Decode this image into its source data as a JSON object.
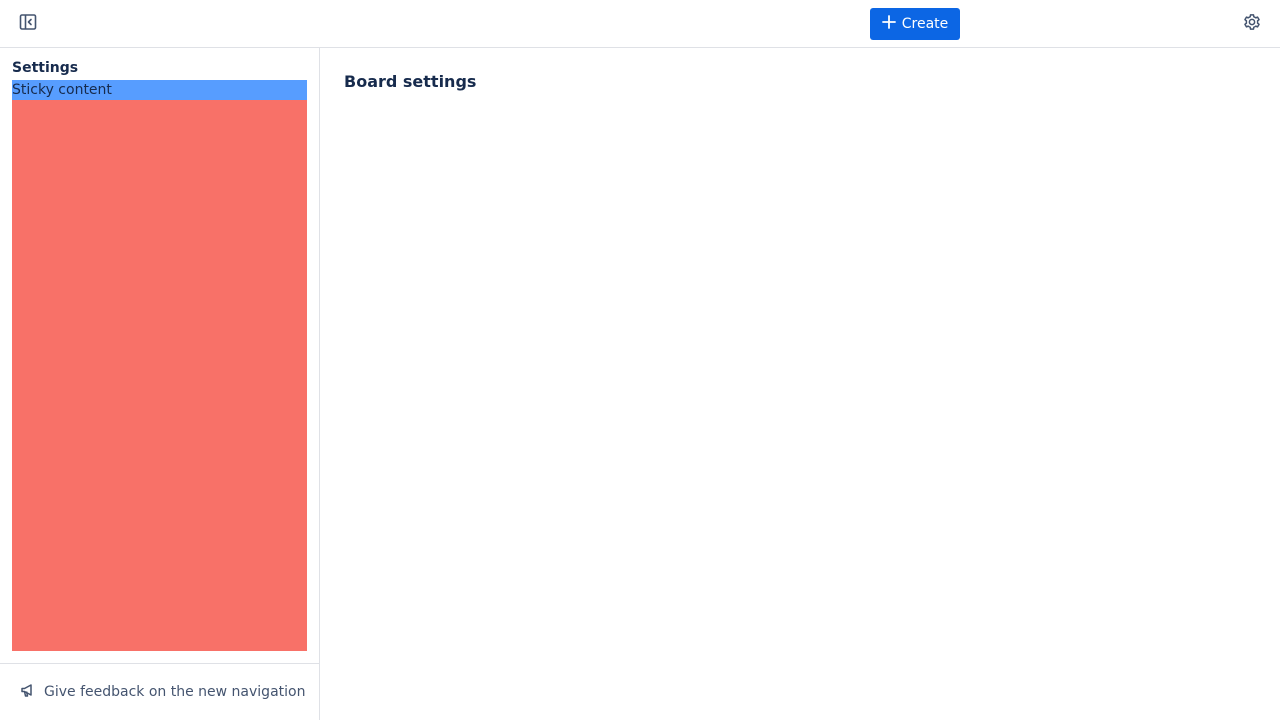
{
  "topbar": {
    "create_label": "Create",
    "sidebar_toggle_icon": "sidebar-collapse-icon",
    "settings_icon": "gear-icon",
    "create_button_color": "#0c66e4"
  },
  "sidebar": {
    "title": "Settings",
    "sticky_label": "Sticky content",
    "sticky_color": "#579dff",
    "filler_color": "#f87168",
    "feedback_label": "Give feedback on the new navigation",
    "feedback_icon": "megaphone-icon"
  },
  "main": {
    "title": "Board settings"
  }
}
